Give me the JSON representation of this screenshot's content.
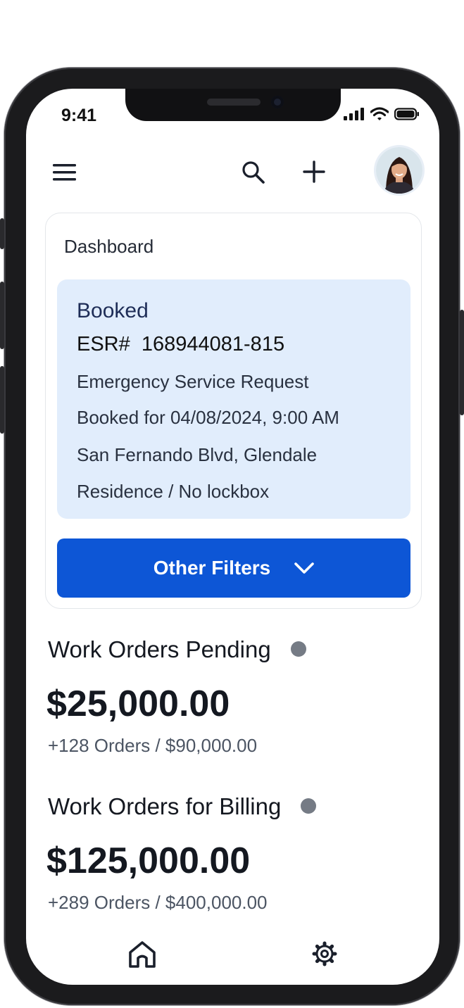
{
  "status_bar": {
    "time": "9:41"
  },
  "header": {
    "menu_icon": "hamburger-menu-icon",
    "search_icon": "search-icon",
    "add_icon": "plus-icon",
    "avatar": "user-avatar"
  },
  "dashboard": {
    "title": "Dashboard",
    "booking": {
      "status": "Booked",
      "esr": "ESR#  168944081-815",
      "type": "Emergency Service Request",
      "booked_for": "Booked for 04/08/2024, 9:00 AM",
      "address": "San Fernando Blvd, Glendale",
      "access": "Residence / No lockbox"
    },
    "filters_label": "Other Filters"
  },
  "metrics": [
    {
      "title": "Work Orders Pending",
      "value": "$25,000.00",
      "sub": "+128 Orders / $90,000.00"
    },
    {
      "title": "Work Orders for Billing",
      "value": "$125,000.00",
      "sub": "+289 Orders / $400,000.00"
    }
  ],
  "bottom_nav": {
    "home_icon": "home-icon",
    "settings_icon": "gear-icon"
  },
  "colors": {
    "accent": "#0d56d6",
    "booking_bg": "#e1edfc",
    "status_dot": "#757b85",
    "text_dark": "#141820"
  }
}
